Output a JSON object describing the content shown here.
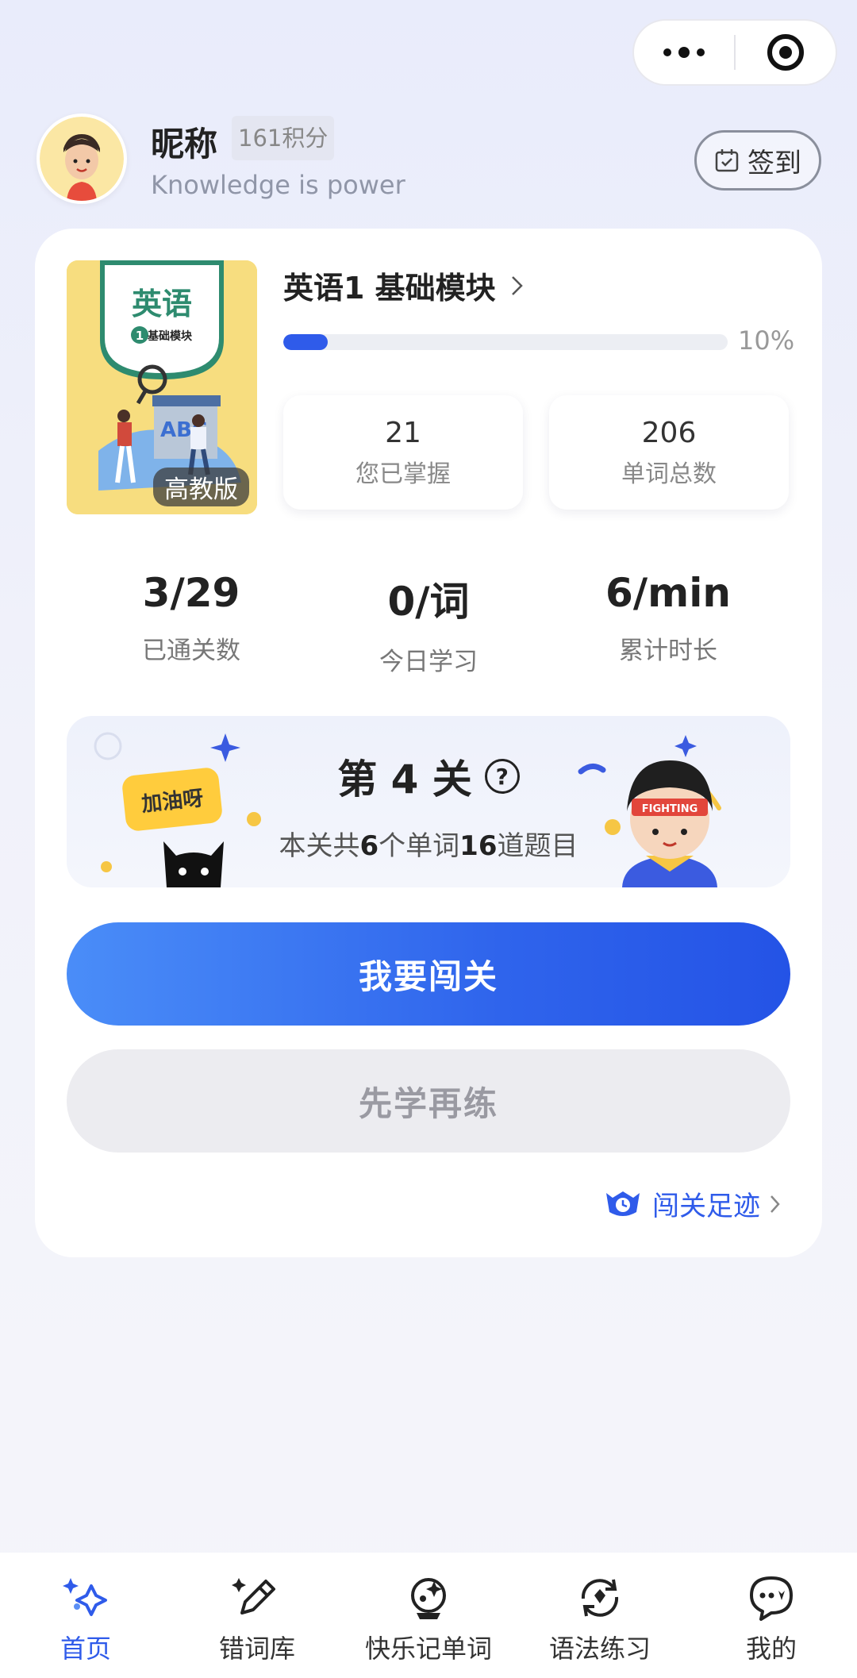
{
  "capsule": {
    "more_icon": "more-dots-icon",
    "close_icon": "target-icon"
  },
  "profile": {
    "nickname": "昵称",
    "points": "161积分",
    "motto": "Knowledge is power",
    "signin_label": "签到"
  },
  "course": {
    "cover_tag": "高教版",
    "cover_title": "英语",
    "cover_subtitle": "基础模块",
    "title": "英语1 基础模块",
    "progress_percent": 10,
    "progress_label": "10%",
    "mastered_value": "21",
    "mastered_label": "您已掌握",
    "total_value": "206",
    "total_label": "单词总数"
  },
  "metrics": [
    {
      "value": "3/29",
      "label": "已通关数"
    },
    {
      "value": "0/词",
      "label": "今日学习"
    },
    {
      "value": "6/min",
      "label": "累计时长"
    }
  ],
  "level": {
    "bubble": "加油呀",
    "title": "第 4 关",
    "desc_pre": "本关共",
    "words": "6",
    "desc_mid": "个单词",
    "questions": "16",
    "desc_post": "道题目",
    "badge_text": "FIGHTING"
  },
  "actions": {
    "primary": "我要闯关",
    "secondary": "先学再练",
    "footprint": "闯关足迹"
  },
  "tabs": [
    {
      "label": "首页",
      "icon": "sparkle-home-icon"
    },
    {
      "label": "错词库",
      "icon": "pencil-ruler-icon"
    },
    {
      "label": "快乐记单词",
      "icon": "crystal-ball-icon"
    },
    {
      "label": "语法练习",
      "icon": "refresh-book-icon"
    },
    {
      "label": "我的",
      "icon": "chat-bubble-icon"
    }
  ],
  "colors": {
    "accent": "#2f5bea",
    "cover_bg": "#f7dd7f"
  }
}
